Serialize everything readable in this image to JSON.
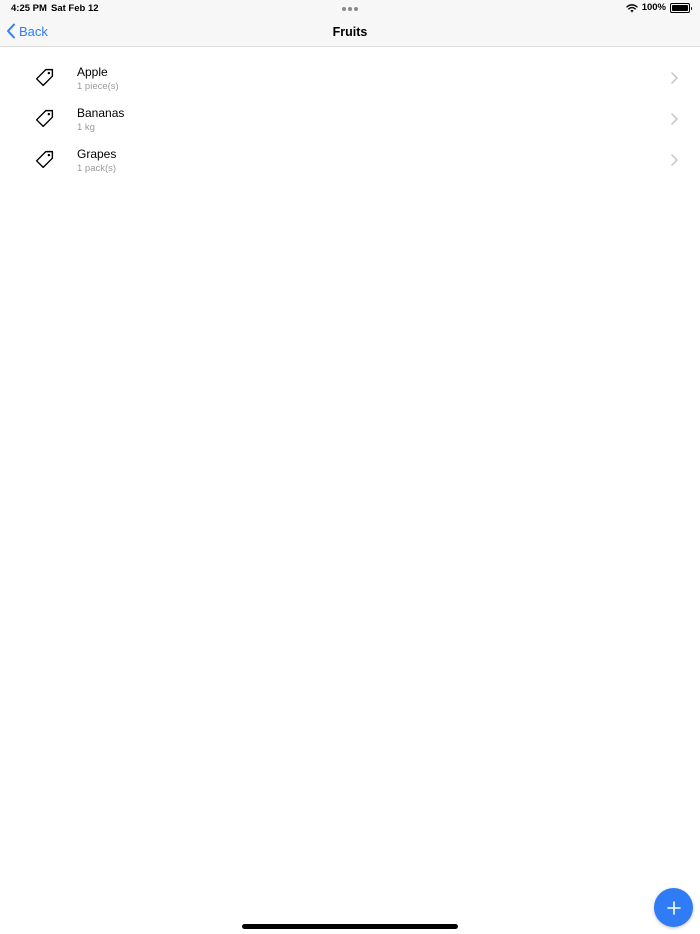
{
  "status_bar": {
    "time": "4:25 PM",
    "date": "Sat Feb 12",
    "battery": "100%"
  },
  "nav": {
    "back_label": "Back",
    "title": "Fruits"
  },
  "items": [
    {
      "name": "Apple",
      "quantity": "1 piece(s)",
      "icon": "tag-icon"
    },
    {
      "name": "Bananas",
      "quantity": "1 kg",
      "icon": "tag-icon"
    },
    {
      "name": "Grapes",
      "quantity": "1 pack(s)",
      "icon": "tag-icon"
    }
  ],
  "fab": {
    "icon": "plus-icon"
  },
  "colors": {
    "accent": "#2f7cf6",
    "secondary_text": "#9a9a9a",
    "bar_background": "#f7f7f7"
  }
}
